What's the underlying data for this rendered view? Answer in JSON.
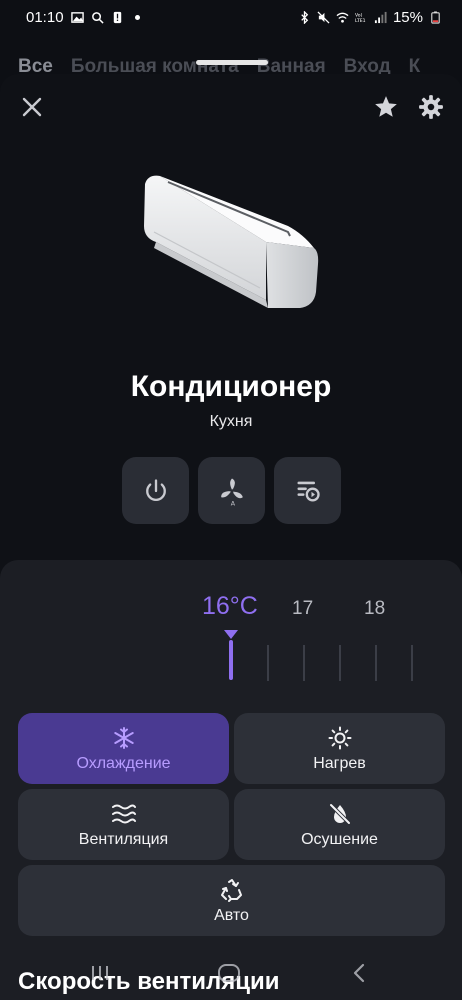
{
  "status_bar": {
    "time": "01:10",
    "battery": "15%"
  },
  "room_tabs": [
    "Все",
    "Большая комната",
    "Ванная",
    "Вход",
    "К"
  ],
  "device": {
    "title": "Кондиционер",
    "room": "Кухня"
  },
  "temperature": {
    "current": "16°C",
    "next": [
      "17",
      "18"
    ],
    "accent_color": "#8f6ff0"
  },
  "modes": {
    "cool": "Охлаждение",
    "heat": "Нагрев",
    "fan": "Вентиляция",
    "dry": "Осушение",
    "auto": "Авто",
    "active": "cool"
  },
  "sections": {
    "fan_speed": "Скорость вентиляции"
  },
  "icons": {
    "close": "close-icon",
    "favorite": "star-icon",
    "settings": "gear-icon",
    "power": "power-icon",
    "fan": "fan-icon",
    "scenario": "scenario-icon"
  }
}
